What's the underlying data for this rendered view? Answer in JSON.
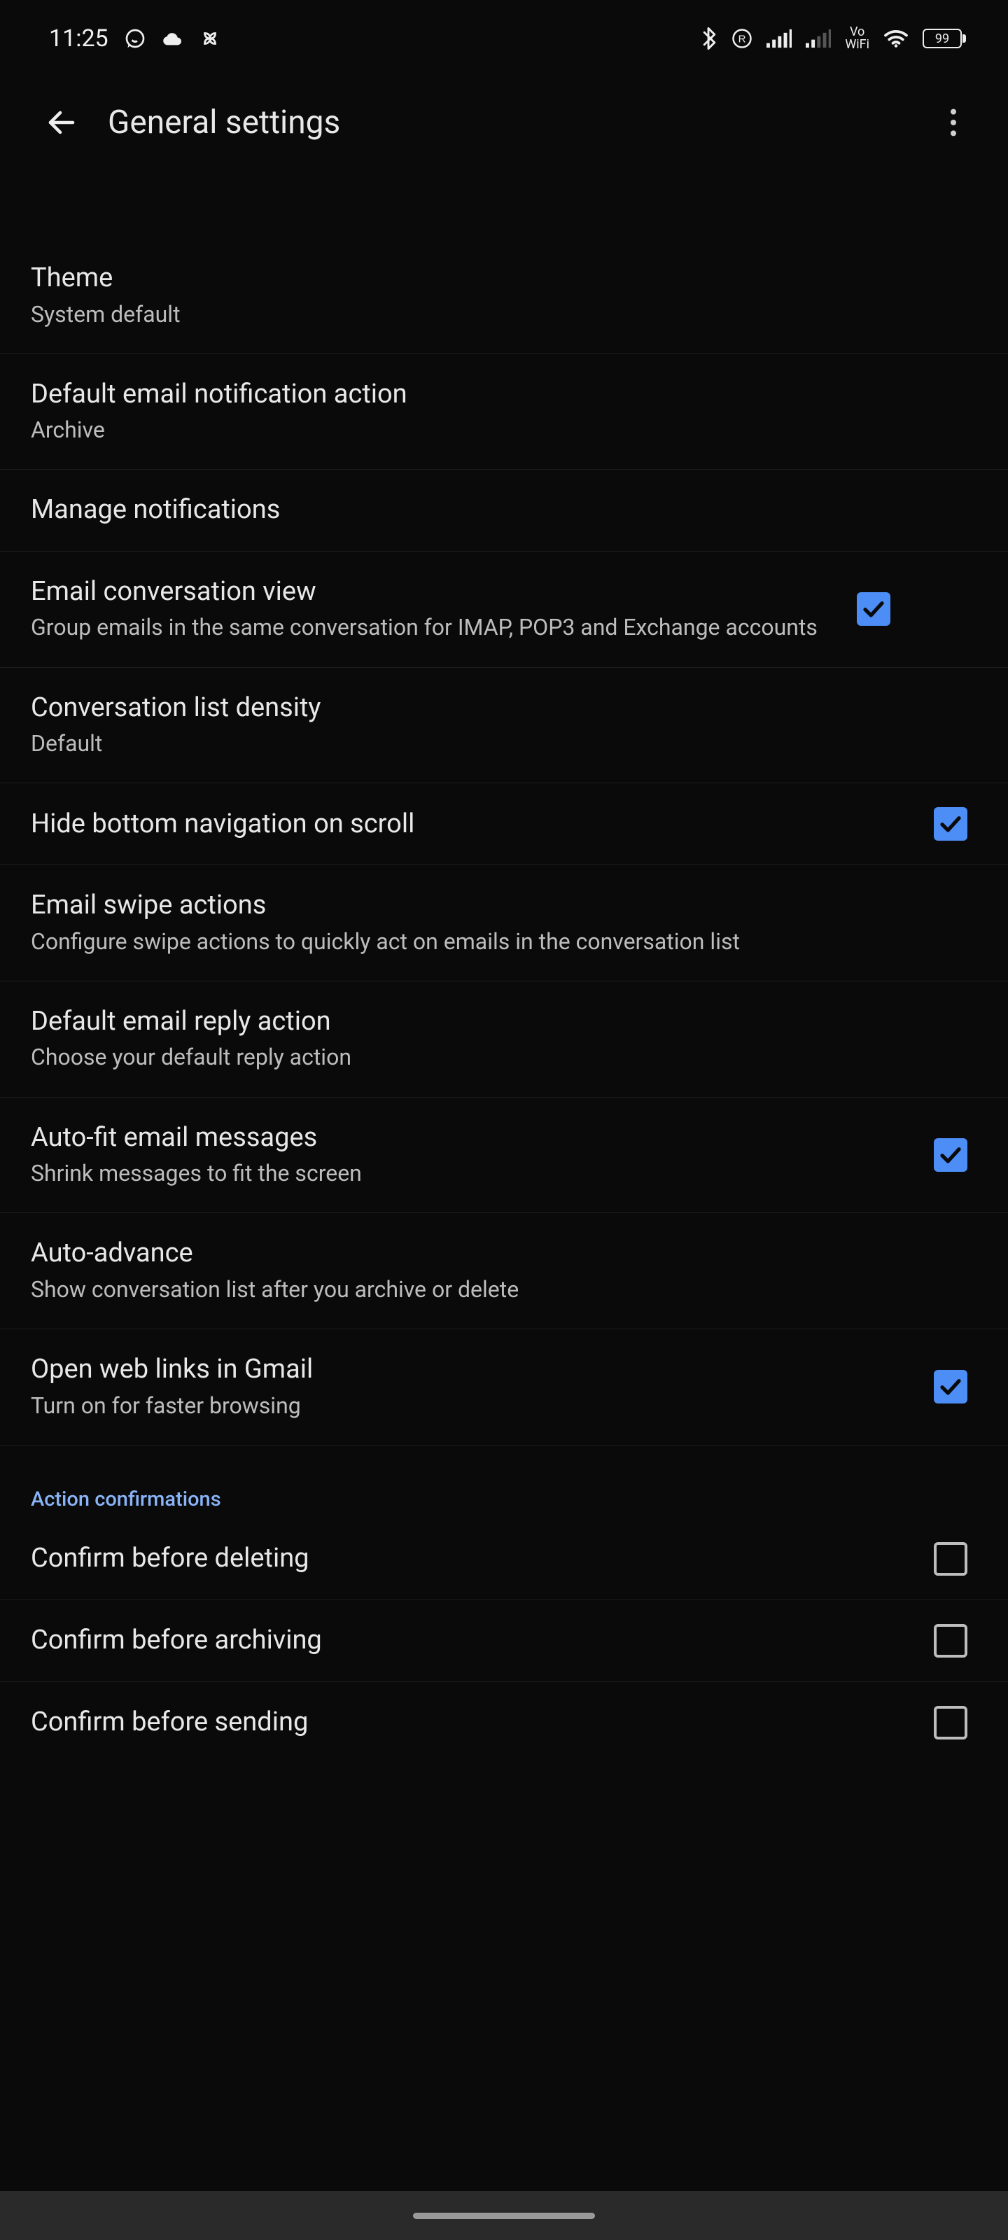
{
  "statusbar": {
    "time": "11:25",
    "battery": "99"
  },
  "header": {
    "title": "General settings"
  },
  "settings": {
    "theme": {
      "title": "Theme",
      "value": "System default"
    },
    "default_notification": {
      "title": "Default email notification action",
      "value": "Archive"
    },
    "manage_notifications": {
      "title": "Manage notifications"
    },
    "conversation_view": {
      "title": "Email conversation view",
      "desc": "Group emails in the same conversation for IMAP, POP3 and Exchange accounts",
      "checked": true
    },
    "list_density": {
      "title": "Conversation list density",
      "value": "Default"
    },
    "hide_bottom_nav": {
      "title": "Hide bottom navigation on scroll",
      "checked": true
    },
    "swipe_actions": {
      "title": "Email swipe actions",
      "desc": "Configure swipe actions to quickly act on emails in the conversation list"
    },
    "default_reply": {
      "title": "Default email reply action",
      "desc": "Choose your default reply action"
    },
    "autofit": {
      "title": "Auto-fit email messages",
      "desc": "Shrink messages to fit the screen",
      "checked": true
    },
    "auto_advance": {
      "title": "Auto-advance",
      "desc": "Show conversation list after you archive or delete"
    },
    "open_web_links": {
      "title": "Open web links in Gmail",
      "desc": "Turn on for faster browsing",
      "checked": true
    }
  },
  "sections": {
    "confirmations": "Action confirmations"
  },
  "confirmations": {
    "delete": {
      "title": "Confirm before deleting",
      "checked": false
    },
    "archive": {
      "title": "Confirm before archiving",
      "checked": false
    },
    "send": {
      "title": "Confirm before sending",
      "checked": false
    }
  }
}
